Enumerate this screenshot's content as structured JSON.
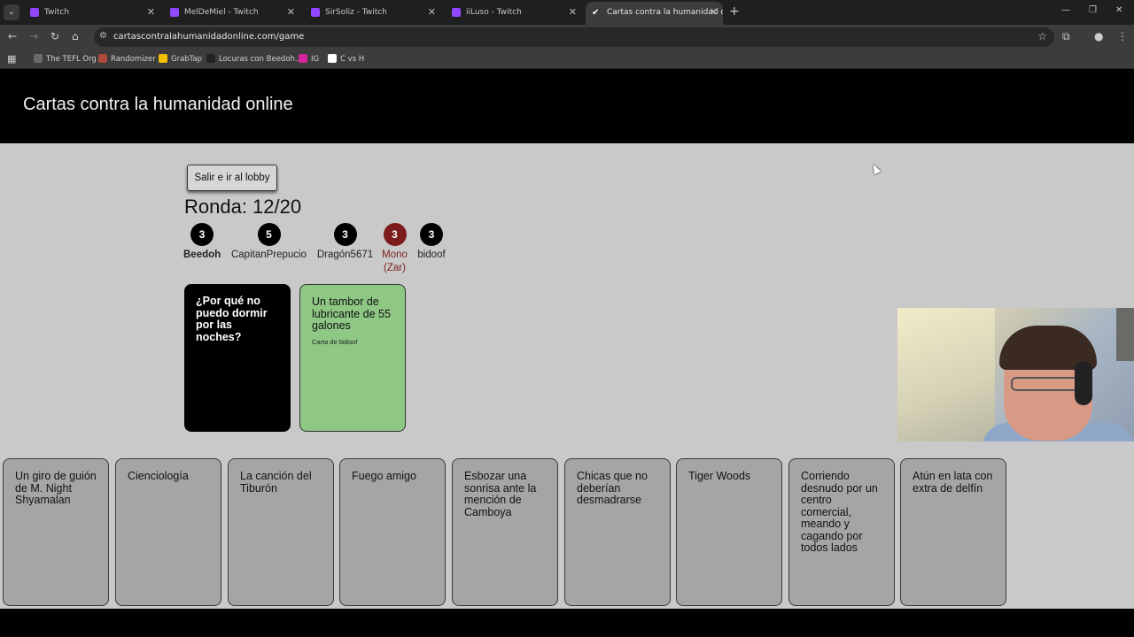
{
  "browser": {
    "tabs": [
      {
        "title": "Twitch",
        "favicon": "twitch-icon"
      },
      {
        "title": "MelDeMiel - Twitch",
        "favicon": "twitch-icon"
      },
      {
        "title": "SirSoliz - Twitch",
        "favicon": "twitch-icon"
      },
      {
        "title": "iiLuso - Twitch",
        "favicon": "twitch-icon"
      },
      {
        "title": "Cartas contra la humanidad onli",
        "favicon": "check-icon",
        "active": true
      }
    ],
    "url": "cartascontralahumanidadonline.com/game",
    "bookmarks": [
      {
        "label": "The TEFL Org",
        "color": "#6a6a6a"
      },
      {
        "label": "Randomizer",
        "color": "#b04a3a"
      },
      {
        "label": "GrabTap",
        "color": "#f0c000"
      },
      {
        "label": "Locuras con Beedoh...",
        "color": "#222222"
      },
      {
        "label": "IG",
        "color": "#d6249f"
      },
      {
        "label": "C vs H",
        "color": "#ffffff"
      }
    ]
  },
  "site": {
    "title": "Cartas contra la humanidad online"
  },
  "game": {
    "lobby_button": "Salir e ir al lobby",
    "round": "Ronda: 12/20",
    "players": [
      {
        "score": "3",
        "name": "Beedoh",
        "me": true
      },
      {
        "score": "5",
        "name": "CapitanPrepucio"
      },
      {
        "score": "3",
        "name": "Dragón5671"
      },
      {
        "score": "3",
        "name": "Mono",
        "role": "(Zar)",
        "czar": true
      },
      {
        "score": "3",
        "name": "bidoof"
      }
    ],
    "black_card": "¿Por qué no puedo dormir por las noches?",
    "played_card": {
      "text": "Un tambor de lubricante de 55 galones",
      "by": "Carta de bidoof"
    },
    "hand": [
      "Un giro de guión de M. Night Shyamalan",
      "Cienciología",
      "La canción del Tiburón",
      "Fuego amigo",
      "Esbozar una sonrisa ante la mención de Camboya",
      "Chicas que no deberían desmadrarse",
      "Tiger Woods",
      "Corriendo desnudo por un centro comercial, meando y cagando por todos lados",
      "Atún en lata con extra de delfín"
    ]
  },
  "colors": {
    "czar": "#7b1b1b",
    "played_card": "#8fc784",
    "hand_card": "#a5a5a5",
    "page_bg": "#c9c9c9"
  }
}
